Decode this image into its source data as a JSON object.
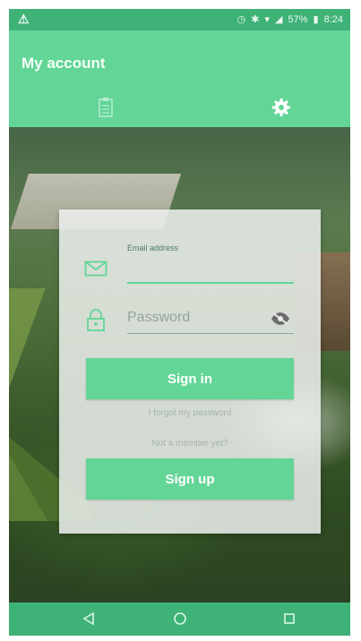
{
  "status_bar": {
    "warning_icon": "warning-triangle-icon",
    "battery_percent": "57%",
    "time": "8:24"
  },
  "header": {
    "title": "My account",
    "tabs": [
      {
        "icon": "clipboard-icon",
        "active": false
      },
      {
        "icon": "gear-icon",
        "active": true
      }
    ]
  },
  "login": {
    "email_label": "Email address",
    "email_value": "",
    "password_placeholder": "Password",
    "signin_label": "Sign in",
    "forgot_label": "I forgot my password",
    "member_label": "Not a member yet?",
    "signup_label": "Sign up"
  },
  "navbar": {
    "back": "back-icon",
    "home": "home-icon",
    "recent": "recent-apps-icon"
  },
  "colors": {
    "accent": "#63d597",
    "status_bar": "#3fb277"
  }
}
